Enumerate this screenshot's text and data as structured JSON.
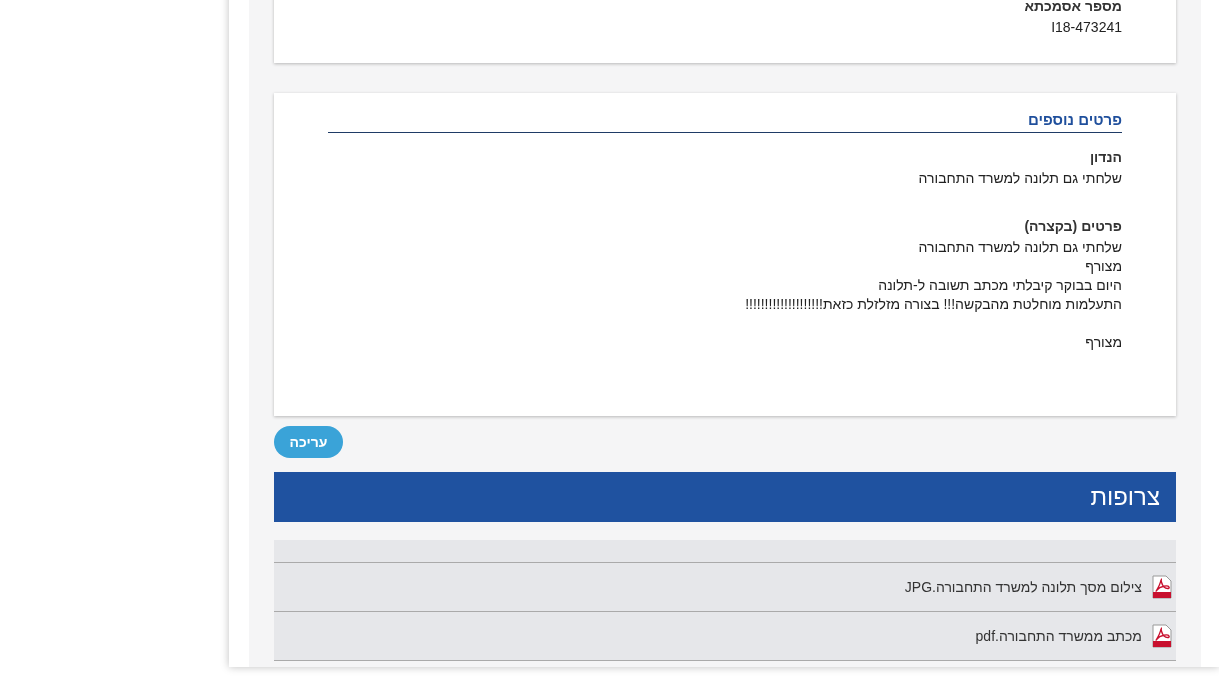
{
  "reference_card": {
    "label": "מספר אסמכתא",
    "value": "I18-473241"
  },
  "details_card": {
    "title": "פרטים נוספים",
    "fields": [
      {
        "label": "הנדון",
        "paragraphs": [
          [
            "שלחתי גם תלונה למשרד התחבורה"
          ]
        ]
      },
      {
        "label": "פרטים (בקצרה)",
        "paragraphs": [
          [
            "שלחתי גם תלונה למשרד התחבורה",
            "מצורף",
            "היום בבוקר קיבלתי מכתב תשובה ל-תלונה",
            "התעלמות מוחלטת מהבקשה!!! בצורה מזלזלת כזאת!!!!!!!!!!!!!!!!!!!!"
          ],
          [
            "מצורף"
          ]
        ]
      }
    ]
  },
  "edit_button": "עריכה",
  "attachments": {
    "title": "צרופות",
    "files": [
      {
        "name": "צילום מסך תלונה למשרד התחבורה.JPG"
      },
      {
        "name": "מכתב ממשרד התחבורה.pdf"
      }
    ]
  }
}
